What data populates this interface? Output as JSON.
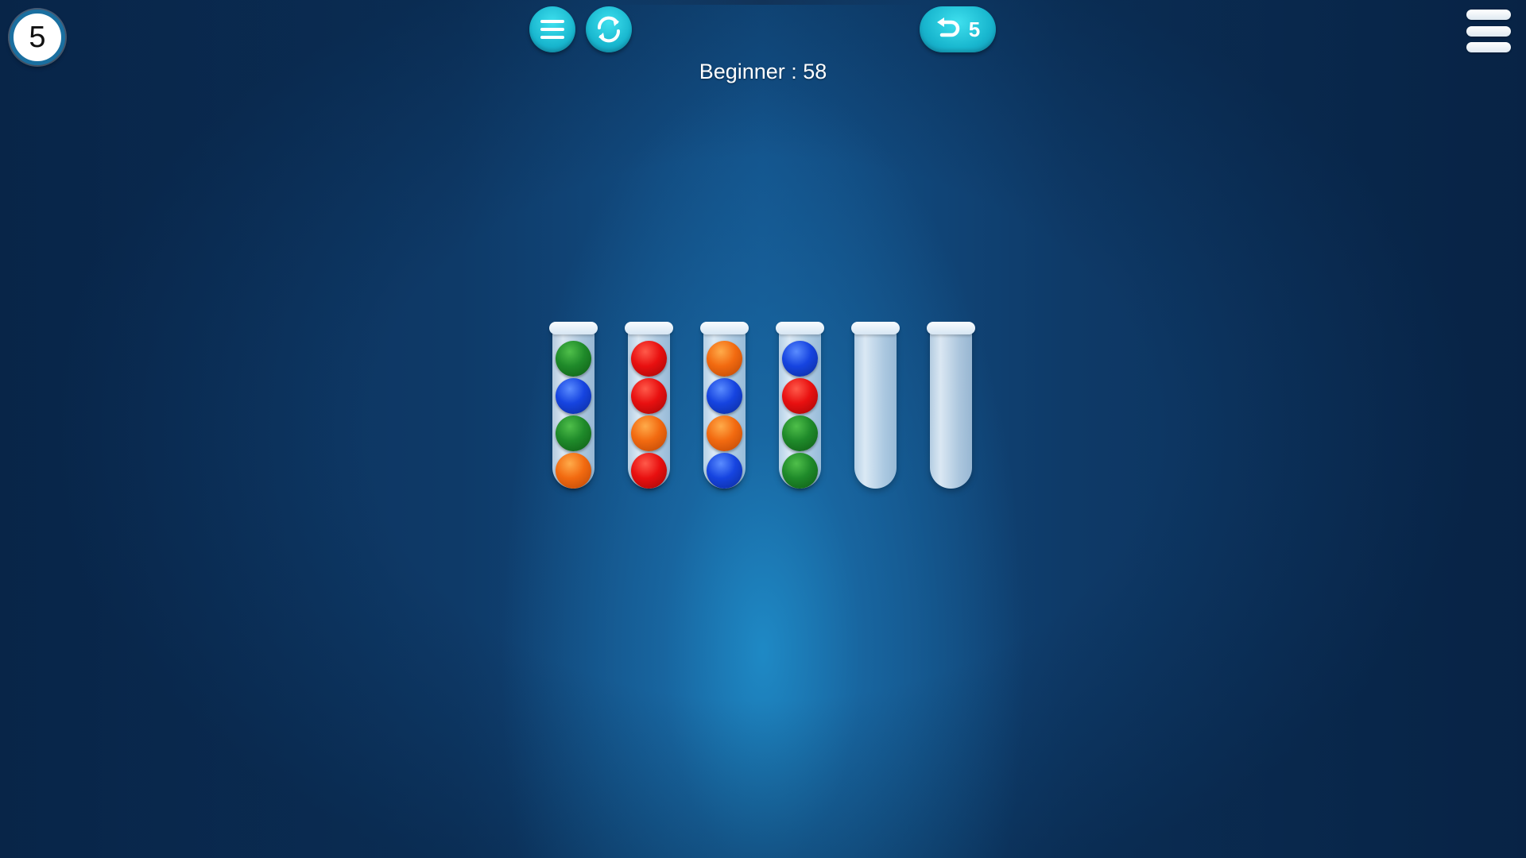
{
  "hud": {
    "level_number": "5",
    "level_title": "Beginner : 58",
    "undo_count": "5"
  },
  "icons": {
    "menu": "list-menu-icon",
    "restart": "restart-icon",
    "undo": "undo-arrow-icon",
    "settings": "hamburger-menu-icon"
  },
  "colors": {
    "green": "#1f8a2a",
    "blue": "#1644e0",
    "red": "#e81010",
    "orange": "#f26a10",
    "button_accent": "#19b7cf"
  },
  "tubes": [
    {
      "balls_top_to_bottom": [
        "green",
        "blue",
        "green",
        "orange"
      ]
    },
    {
      "balls_top_to_bottom": [
        "red",
        "red",
        "orange",
        "red"
      ]
    },
    {
      "balls_top_to_bottom": [
        "orange",
        "blue",
        "orange",
        "blue"
      ]
    },
    {
      "balls_top_to_bottom": [
        "blue",
        "red",
        "green",
        "green"
      ]
    },
    {
      "balls_top_to_bottom": []
    },
    {
      "balls_top_to_bottom": []
    }
  ]
}
